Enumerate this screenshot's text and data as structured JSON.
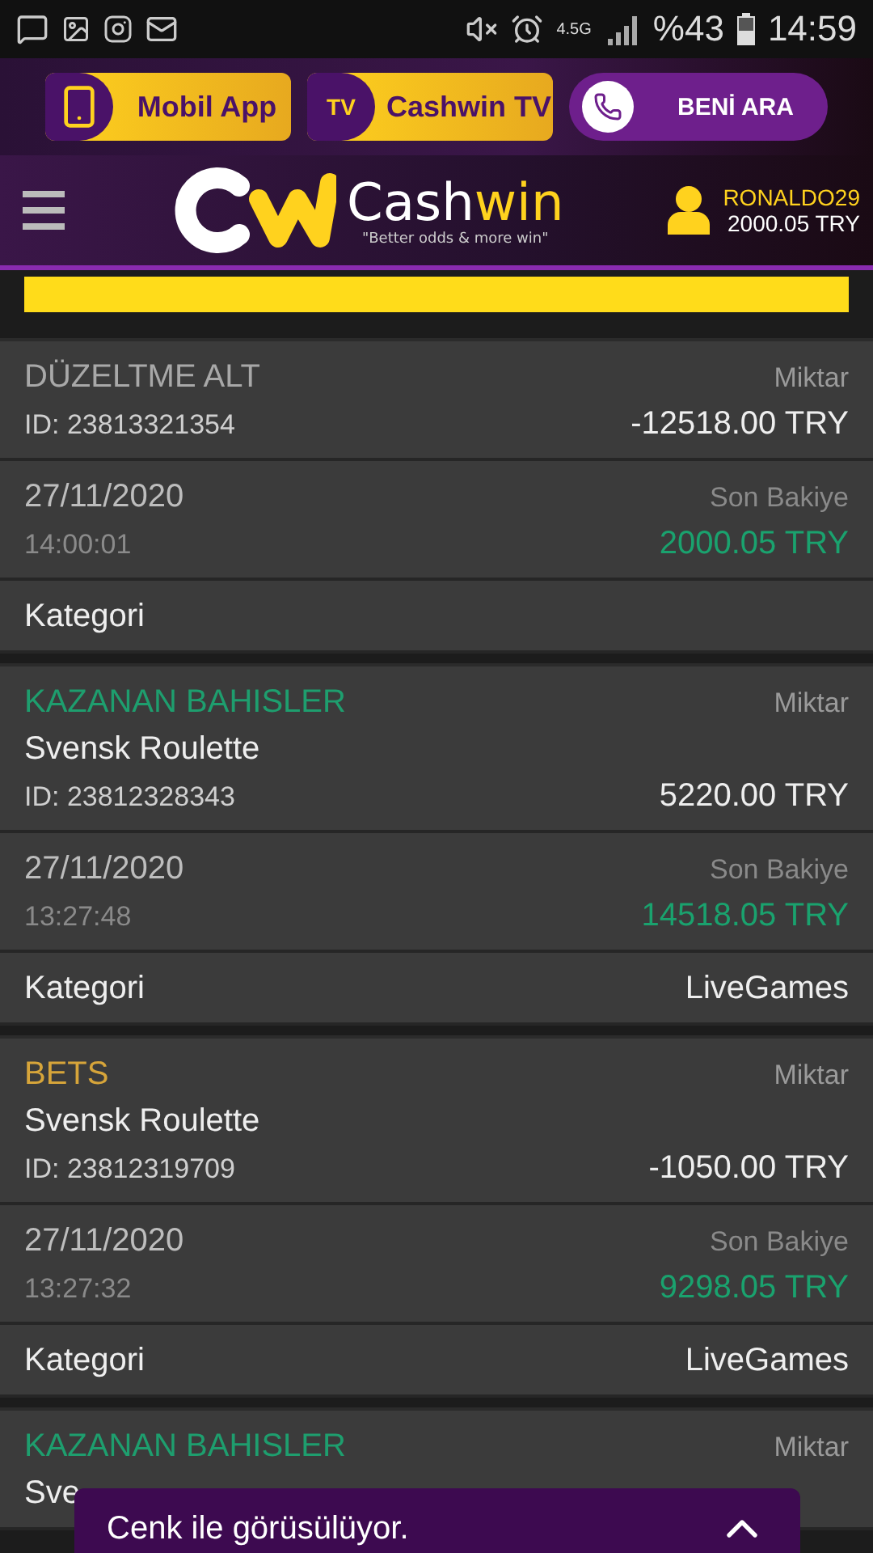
{
  "status_bar": {
    "network": "4.5G",
    "battery": "%43",
    "time": "14:59"
  },
  "promo": {
    "buttons": [
      {
        "kind": "app",
        "label": "Mobil App"
      },
      {
        "kind": "tv",
        "label": "Cashwin TV",
        "icon_text": "TV"
      },
      {
        "kind": "call",
        "label": "BENİ ARA"
      }
    ]
  },
  "header": {
    "logo_left": "Cash",
    "logo_right": "win",
    "slogan": "\"Better odds & more win\"",
    "username": "RONALDO29",
    "balance": "2000.05 TRY"
  },
  "transactions": [
    {
      "kind": "adjustment",
      "type": "DÜZELTME ALT",
      "amount_label": "Miktar",
      "id": "ID: 23813321354",
      "amount": "-12518.00 TRY",
      "date": "27/11/2020",
      "time": "14:00:01",
      "balance_label": "Son Bakiye",
      "balance": "2000.05 TRY",
      "category_label": "Kategori"
    },
    {
      "kind": "win",
      "type": "KAZANAN BAHISLER",
      "amount_label": "Miktar",
      "name": "Svensk Roulette",
      "id": "ID: 23812328343",
      "amount": "5220.00 TRY",
      "date": "27/11/2020",
      "time": "13:27:48",
      "balance_label": "Son Bakiye",
      "balance": "14518.05 TRY",
      "category_label": "Kategori",
      "category": "LiveGames"
    },
    {
      "kind": "bet",
      "type": "BETS",
      "amount_label": "Miktar",
      "name": "Svensk Roulette",
      "id": "ID: 23812319709",
      "amount": "-1050.00 TRY",
      "date": "27/11/2020",
      "time": "13:27:32",
      "balance_label": "Son Bakiye",
      "balance": "9298.05 TRY",
      "category_label": "Kategori",
      "category": "LiveGames"
    },
    {
      "kind": "win",
      "type": "KAZANAN BAHISLER",
      "amount_label": "Miktar",
      "name": "Sve"
    }
  ],
  "chat_bar": {
    "text": "Cenk ile görüsülüyor.",
    "expanded": false
  }
}
